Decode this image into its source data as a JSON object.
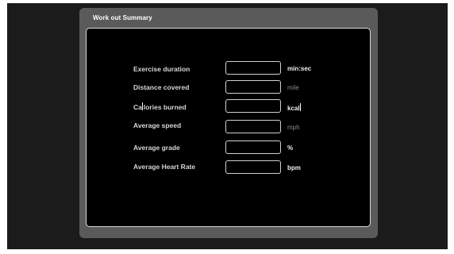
{
  "window": {
    "title": "Work out  Summary"
  },
  "rows": [
    {
      "label": "Exercise duration",
      "value": "",
      "unit": "min:sec",
      "unit_style": "strong"
    },
    {
      "label": "Distance covered",
      "value": "",
      "unit": "mile",
      "unit_style": "dim"
    },
    {
      "label": "Calories burned",
      "value": "",
      "unit": "kcal",
      "unit_style": "strong"
    },
    {
      "label": "Average speed",
      "value": "",
      "unit": "mph",
      "unit_style": "dim"
    },
    {
      "label": "Average grade",
      "value": "",
      "unit": "%",
      "unit_style": "strong"
    },
    {
      "label": "Average Heart Rate",
      "value": "",
      "unit": "bpm",
      "unit_style": "strong"
    }
  ],
  "colors": {
    "window_bg": "#5a5a5a",
    "panel_bg": "#000000",
    "panel_border": "#d9d9d9",
    "label_text": "#d6d6d6",
    "unit_strong": "#f2f2f2",
    "unit_dim": "#8a8a8a"
  },
  "icons": {
    "text_cursor": "text-cursor-icon"
  }
}
